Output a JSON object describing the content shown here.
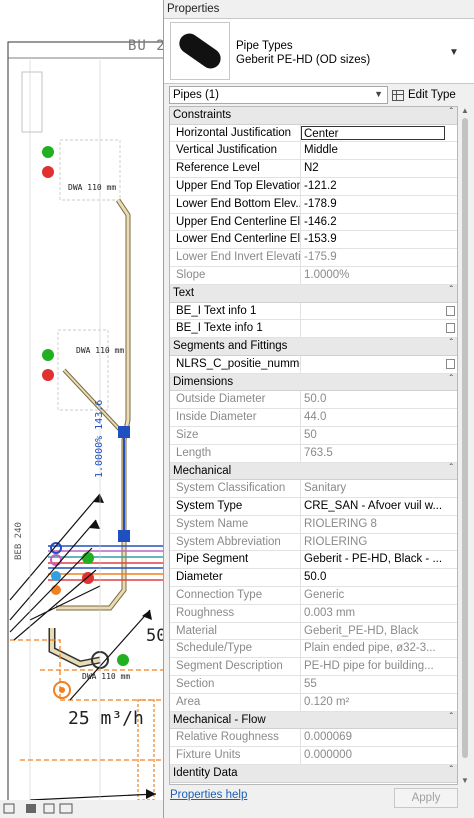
{
  "drawing": {
    "title_fragment": "BU 2",
    "flow_label": "25 m³/h",
    "dim_label": "50",
    "slope_label": "1.0000% 143.6",
    "tag_1": "DWA 110 mm",
    "tag_2": "DWA 110 mm",
    "tag_3": "DWA 110 mm",
    "side_label": "BEB 240"
  },
  "panel": {
    "title": "Properties",
    "type_family": "Pipe Types",
    "type_name": "Geberit PE-HD (OD sizes)",
    "type_dropdown_icon": "chevron-down-icon",
    "selector_label": "Pipes (1)",
    "edit_type_label": "Edit Type",
    "help_link": "Properties help",
    "apply_label": "Apply"
  },
  "groups": [
    {
      "label": "Constraints",
      "rows": [
        {
          "name": "Horizontal Justification",
          "value": "Center",
          "readonly": false,
          "selected": true
        },
        {
          "name": "Vertical Justification",
          "value": "Middle",
          "readonly": false
        },
        {
          "name": "Reference Level",
          "value": "N2",
          "readonly": false
        },
        {
          "name": "Upper End Top Elevation",
          "value": "-121.2",
          "readonly": false
        },
        {
          "name": "Lower End Bottom Elev...",
          "value": "-178.9",
          "readonly": false
        },
        {
          "name": "Upper End Centerline El...",
          "value": "-146.2",
          "readonly": false
        },
        {
          "name": "Lower End Centerline El...",
          "value": "-153.9",
          "readonly": false
        },
        {
          "name": "Lower End Invert Elevati...",
          "value": "-175.9",
          "readonly": true
        },
        {
          "name": "Slope",
          "value": "1.0000%",
          "readonly": true
        }
      ]
    },
    {
      "label": "Text",
      "rows": [
        {
          "name": "BE_I Text info 1",
          "value": "",
          "readonly": false,
          "checkbox": true
        },
        {
          "name": "BE_I Texte info 1",
          "value": "",
          "readonly": false,
          "checkbox": true
        }
      ]
    },
    {
      "label": "Segments and Fittings",
      "rows": [
        {
          "name": "NLRS_C_positie_nummer",
          "value": "",
          "readonly": false,
          "checkbox": true
        }
      ]
    },
    {
      "label": "Dimensions",
      "rows": [
        {
          "name": "Outside Diameter",
          "value": "50.0",
          "readonly": true
        },
        {
          "name": "Inside Diameter",
          "value": "44.0",
          "readonly": true
        },
        {
          "name": "Size",
          "value": "50",
          "readonly": true
        },
        {
          "name": "Length",
          "value": "763.5",
          "readonly": true
        }
      ]
    },
    {
      "label": "Mechanical",
      "rows": [
        {
          "name": "System Classification",
          "value": "Sanitary",
          "readonly": true
        },
        {
          "name": "System Type",
          "value": "CRE_SAN - Afvoer vuil w...",
          "readonly": false
        },
        {
          "name": "System Name",
          "value": "RIOLERING 8",
          "readonly": true
        },
        {
          "name": "System Abbreviation",
          "value": "RIOLERING",
          "readonly": true
        },
        {
          "name": "Pipe Segment",
          "value": "Geberit - PE-HD, Black - ...",
          "readonly": false
        },
        {
          "name": "Diameter",
          "value": "50.0",
          "readonly": false
        },
        {
          "name": "Connection Type",
          "value": "Generic",
          "readonly": true
        },
        {
          "name": "Roughness",
          "value": "0.003 mm",
          "readonly": true
        },
        {
          "name": "Material",
          "value": "Geberit_PE-HD, Black",
          "readonly": true
        },
        {
          "name": "Schedule/Type",
          "value": "Plain ended pipe, ø32-3...",
          "readonly": true
        },
        {
          "name": "Segment Description",
          "value": "PE-HD pipe for building...",
          "readonly": true
        },
        {
          "name": "Section",
          "value": "55",
          "readonly": true
        },
        {
          "name": "Area",
          "value": "0.120 m²",
          "readonly": true
        }
      ]
    },
    {
      "label": "Mechanical - Flow",
      "rows": [
        {
          "name": "Relative Roughness",
          "value": "0.000069",
          "readonly": true
        },
        {
          "name": "Fixture Units",
          "value": "0.000000",
          "readonly": true
        }
      ]
    },
    {
      "label": "Identity Data",
      "rows": []
    }
  ],
  "colors": {
    "link": "#1a5fb4",
    "readonly_text": "#8a8a8a",
    "group_bg": "#e8e8e8",
    "pipe_orange": "#f08020",
    "pipe_blue": "#2050c0"
  }
}
